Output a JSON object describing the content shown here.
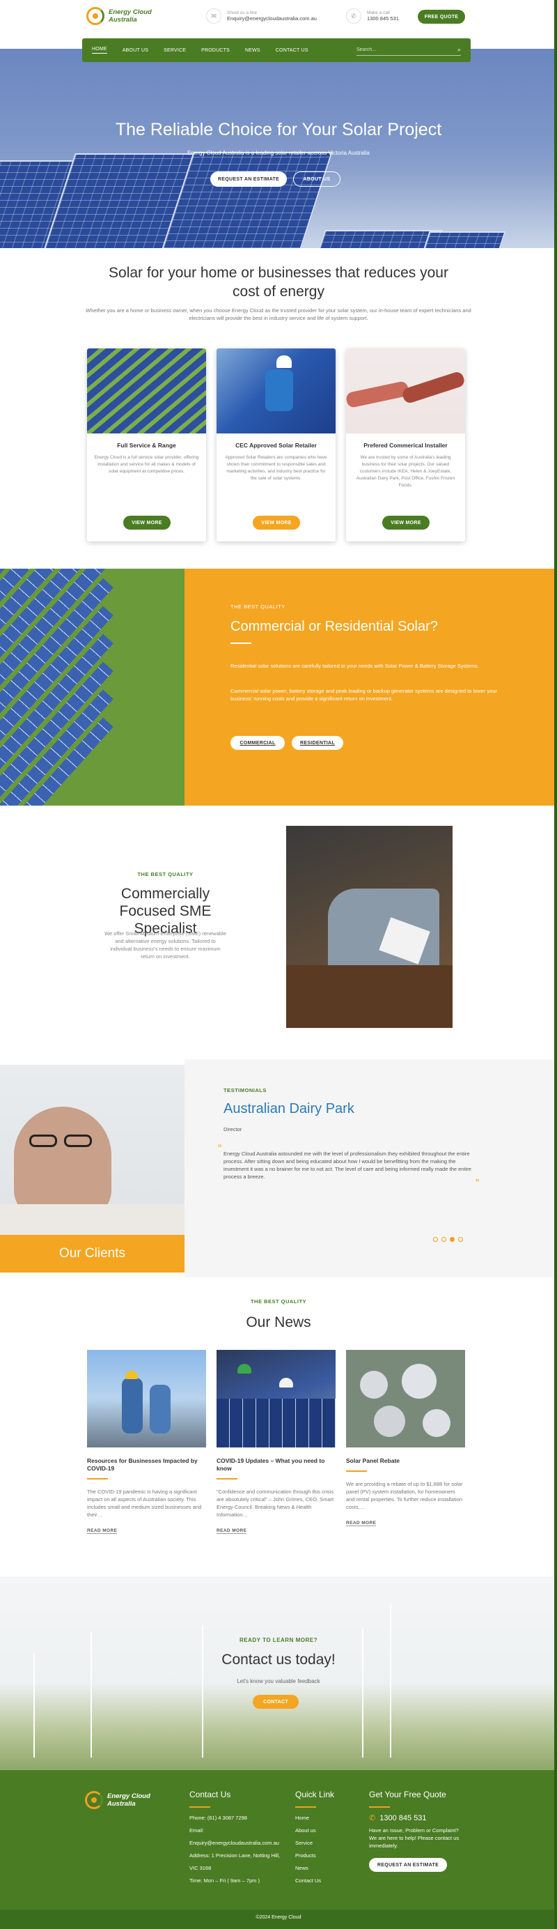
{
  "header": {
    "logo_line1": "Energy Cloud",
    "logo_line2": "Australia",
    "email_label": "Shoot us a line",
    "email": "Enquiry@energycloudaustralia.com.au",
    "phone_label": "Make a call",
    "phone": "1300 845 531",
    "quote_button": "FREE QUOTE"
  },
  "nav": {
    "items": [
      "HOME",
      "ABOUT US",
      "SERVICE",
      "PRODUCTS",
      "NEWS",
      "CONTACT US"
    ],
    "search_placeholder": "Search..."
  },
  "hero": {
    "title": "The Reliable Choice for Your Solar Project",
    "subtitle": "Energy Cloud Australia is a leading solar retailer accross Victoria Australia",
    "btn_estimate": "REQUEST AN ESTIMATE",
    "btn_about": "ABOUT US"
  },
  "intro": {
    "title": "Solar for your home or businesses that reduces your cost of energy",
    "text": "Whether you are a home or business owner, when you choose Energy Cloud as the trusted provider for your solar system, our in-house team of expert technicians and electricians will provide the best in industry service and life of system support."
  },
  "cards": [
    {
      "title": "Full Service & Range",
      "text": "Energy Cloud is a full service solar provider, offering installation and service for all makes & models of solar equipment at competitive prices.",
      "button": "VIEW MORE"
    },
    {
      "title": "CEC Approved Solar Retailer",
      "text": "Approved Solar Retailers are companies who have shown their commitment to responsible sales and marketing activities, and industry best practice for the sale of solar systems.",
      "button": "VIEW MORE"
    },
    {
      "title": "Prefered Commerical Installer",
      "text": "We are trusted by some of Australia's leading business for their solar projects. Our valued customers include IKEA, Helen & JoeyEstate, Australian Dairy Park, Post Office, Fushin Frozen Foods.",
      "button": "VIEW MORE"
    }
  ],
  "commercial": {
    "eyebrow": "THE BEST QUALITY",
    "title": "Commercial or Residential Solar?",
    "p1": "Residential solar solutions are carefully tailored to your needs with Solar Power & Battery Storage Systems.",
    "p2": "Commercial solar power, battery storage and peak loading or backup generator systems are designed to lower your business' running costs and provide a significant return on investment.",
    "btn1": "COMMERCIAL",
    "btn2": "RESIDENTIAL"
  },
  "sme": {
    "eyebrow": "THE BEST QUALITY",
    "title": "Commercially Focused SME Specialist",
    "text": "We offer Small-Medium-Enterprise (SME) renewable and alternative energy solutions. Tailored to individual business's needs to ensure maximum return on investment."
  },
  "testimonial": {
    "clients_label": "Our Clients",
    "eyebrow": "TESTIMONIALS",
    "name": "Australian Dairy Park",
    "role": "Director",
    "quote": "Energy Cloud Australia astounded me with the level of professionalism they exhibited throughout the entire process. After sitting down and being educated about how I would be benefitting from the making the investment it was a no brainer for me to not act. The level of care and being informed really made the entire process a breeze.",
    "active_dot": 3
  },
  "news": {
    "eyebrow": "THE BEST QUALITY",
    "title": "Our News",
    "items": [
      {
        "title": "Resources for Businesses Impacted by COVID-19",
        "text": "The COVID-19 pandemic is having a significant impact on all aspects of Australian society. This includes small and medium sized businesses and their…",
        "link": "READ MORE"
      },
      {
        "title": "COVID-19 Updates – What you need to know",
        "text": "\"Confidence and communication through this crisis are absolutely critical\" – John Grimes, CEO, Smart Energy Council. Breaking News & Health Information…",
        "link": "READ MORE"
      },
      {
        "title": "Solar Panel Rebate",
        "text": "We are providing a rebate of up to $1,888 for solar panel (PV) system installation, for homeowners and rental properties. To further reduce installation costs,…",
        "link": "READ MORE"
      }
    ]
  },
  "cta": {
    "eyebrow": "READY TO LEARN MORE?",
    "title": "Contact us today!",
    "text": "Let's know you valuable feedback",
    "button": "CONTACT"
  },
  "footer": {
    "contact_heading": "Contact Us",
    "phone": "Phone: (61) 4 3087 7298",
    "email_label": "Email:",
    "email": "Enquiry@energycloudaustralia.com.au",
    "address1": "Address: 1 Precision Lane, Notting Hill,",
    "address2": "VIC 3168",
    "time": "Time: Mon – Fri ( 9am – 7pm )",
    "links_heading": "Quick Link",
    "links": [
      "Home",
      "About us",
      "Service",
      "Products",
      "News",
      "Contact Us"
    ],
    "quote_heading": "Get Your Free Quote",
    "quote_phone": "1300 845 531",
    "quote_text": "Have an Issue, Problem or Complaint? We are here to help! Please contact us immediately.",
    "quote_button": "REQUEST AN ESTIMATE",
    "copyright": "©2024 Energy Cloud"
  },
  "colors": {
    "green": "#4a7c23",
    "orange": "#f4a521",
    "blue": "#2a7ab8"
  }
}
